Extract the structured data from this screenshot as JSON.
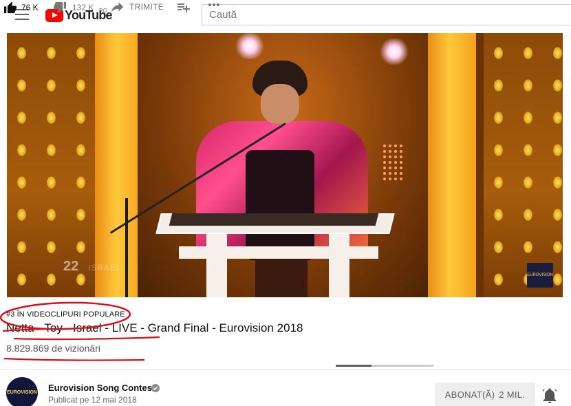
{
  "header": {
    "logo_text": "YouTube",
    "country_code": "RO",
    "search_placeholder": "Caută"
  },
  "player": {
    "overlay_number": "22",
    "overlay_country": "ISRAEL",
    "corner_logo": "EUROVISION"
  },
  "video": {
    "trending_tag": "#3 ÎN VIDEOCLIPURI POPULARE",
    "title": "Netta - Toy - Israel - LIVE - Grand Final - Eurovision 2018",
    "views": "8.829.869 de vizionări"
  },
  "actions": {
    "likes": "76 K",
    "dislikes": "132 K",
    "share_label": "TRIMITE",
    "like_ratio": 0.365
  },
  "channel": {
    "name": "Eurovision Song Contest",
    "published": "Publicat pe 12 mai 2018",
    "avatar_text": "EUROVISION",
    "subscribe_label": "ABONAT(Ă)",
    "subscriber_count": "2 MIL."
  },
  "colors": {
    "brand_red": "#ff0000",
    "annotation_red": "#d8101b"
  }
}
